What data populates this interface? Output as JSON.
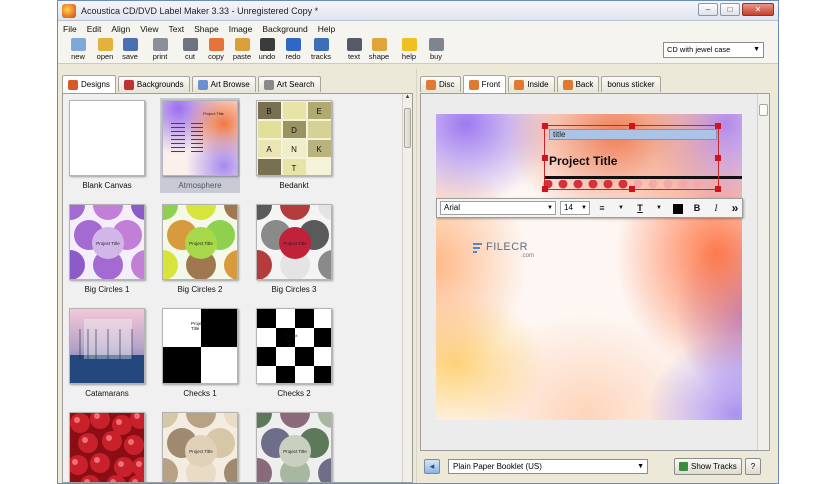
{
  "window": {
    "title": "Acoustica CD/DVD Label Maker 3.33 - Unregistered Copy *",
    "controls": {
      "minimize": "–",
      "maximize": "□",
      "close": "✕"
    }
  },
  "menu": [
    "File",
    "Edit",
    "Align",
    "View",
    "Text",
    "Shape",
    "Image",
    "Background",
    "Help"
  ],
  "toolbar": {
    "tools": [
      {
        "label": "new",
        "icon": "new-doc-icon",
        "color": "#7ea8d8"
      },
      {
        "label": "open",
        "icon": "folder-open-icon",
        "color": "#e2b23c"
      },
      {
        "label": "save",
        "icon": "floppy-disk-icon",
        "color": "#4b6fb0"
      },
      {
        "label": "print",
        "icon": "printer-icon",
        "color": "#8a8f99"
      },
      {
        "label": "cut",
        "icon": "scissors-icon",
        "color": "#6d7480"
      },
      {
        "label": "copy",
        "icon": "copy-icon",
        "color": "#e6733b"
      },
      {
        "label": "paste",
        "icon": "paste-icon",
        "color": "#d9a03a"
      },
      {
        "label": "undo",
        "icon": "undo-icon",
        "color": "#3b3b3b"
      },
      {
        "label": "redo",
        "icon": "redo-icon",
        "color": "#2f68c4"
      },
      {
        "label": "tracks",
        "icon": "tracks-icon",
        "color": "#3d6fb6"
      },
      {
        "label": "text",
        "icon": "text-icon",
        "color": "#555a66"
      },
      {
        "label": "shape",
        "icon": "shape-icon",
        "color": "#e0a43c"
      },
      {
        "label": "help",
        "icon": "help-icon",
        "color": "#f0c020"
      },
      {
        "label": "buy",
        "icon": "cart-icon",
        "color": "#7d8590"
      }
    ],
    "case_select": "CD with jewel case"
  },
  "left_tabs": [
    {
      "label": "Designs",
      "icon": "designs-icon",
      "color": "#d45a2a"
    },
    {
      "label": "Backgrounds",
      "icon": "backgrounds-icon",
      "color": "#c03030"
    },
    {
      "label": "Art Browse",
      "icon": "art-browse-icon",
      "color": "#6b8fcf"
    },
    {
      "label": "Art Search",
      "icon": "art-search-icon",
      "color": "#8a8a8a"
    }
  ],
  "designs": [
    {
      "caption": "Blank Canvas",
      "style": "blank"
    },
    {
      "caption": "Atmosphere",
      "style": "atmosphere",
      "selected": true
    },
    {
      "caption": "Bedankt",
      "style": "bedankt",
      "letters": [
        "B",
        "E",
        "D",
        "A",
        "N",
        "K",
        "T"
      ]
    },
    {
      "caption": "Big Circles 1",
      "style": "circles1",
      "center": "Project Title"
    },
    {
      "caption": "Big Circles 2",
      "style": "circles2",
      "center": "Project Title"
    },
    {
      "caption": "Big Circles 3",
      "style": "circles3",
      "center": "Project Title"
    },
    {
      "caption": "Catamarans",
      "style": "catamarans"
    },
    {
      "caption": "Checks 1",
      "style": "checks1",
      "text": "Project Title"
    },
    {
      "caption": "Checks 2",
      "style": "checks2",
      "text": "Project Title"
    },
    {
      "caption": "",
      "style": "cherries"
    },
    {
      "caption": "",
      "style": "beige-circles"
    },
    {
      "caption": "",
      "style": "green-circles"
    }
  ],
  "right_tabs": [
    {
      "label": "Disc",
      "icon": "disc-icon",
      "color": "#e07a30"
    },
    {
      "label": "Front",
      "icon": "front-icon",
      "color": "#e07a30",
      "active": true
    },
    {
      "label": "Inside",
      "icon": "inside-icon",
      "color": "#e07a30"
    },
    {
      "label": "Back",
      "icon": "back-icon",
      "color": "#e07a30"
    },
    {
      "label": "bonus sticker",
      "icon": "",
      "color": ""
    }
  ],
  "canvas": {
    "title_field": "title",
    "project_title": "Project Title",
    "accent_color": "#c1272d"
  },
  "format_bar": {
    "font": "Arial",
    "size": "14",
    "align": "≡",
    "text_color": "T",
    "bold": "B",
    "italic": "I",
    "more": "»"
  },
  "watermark": {
    "text": "FILECR",
    "sub": ".com"
  },
  "bottom": {
    "nav": "◂",
    "booklet": "Plain Paper Booklet (US)",
    "show_tracks": "Show Tracks",
    "help": "?"
  }
}
